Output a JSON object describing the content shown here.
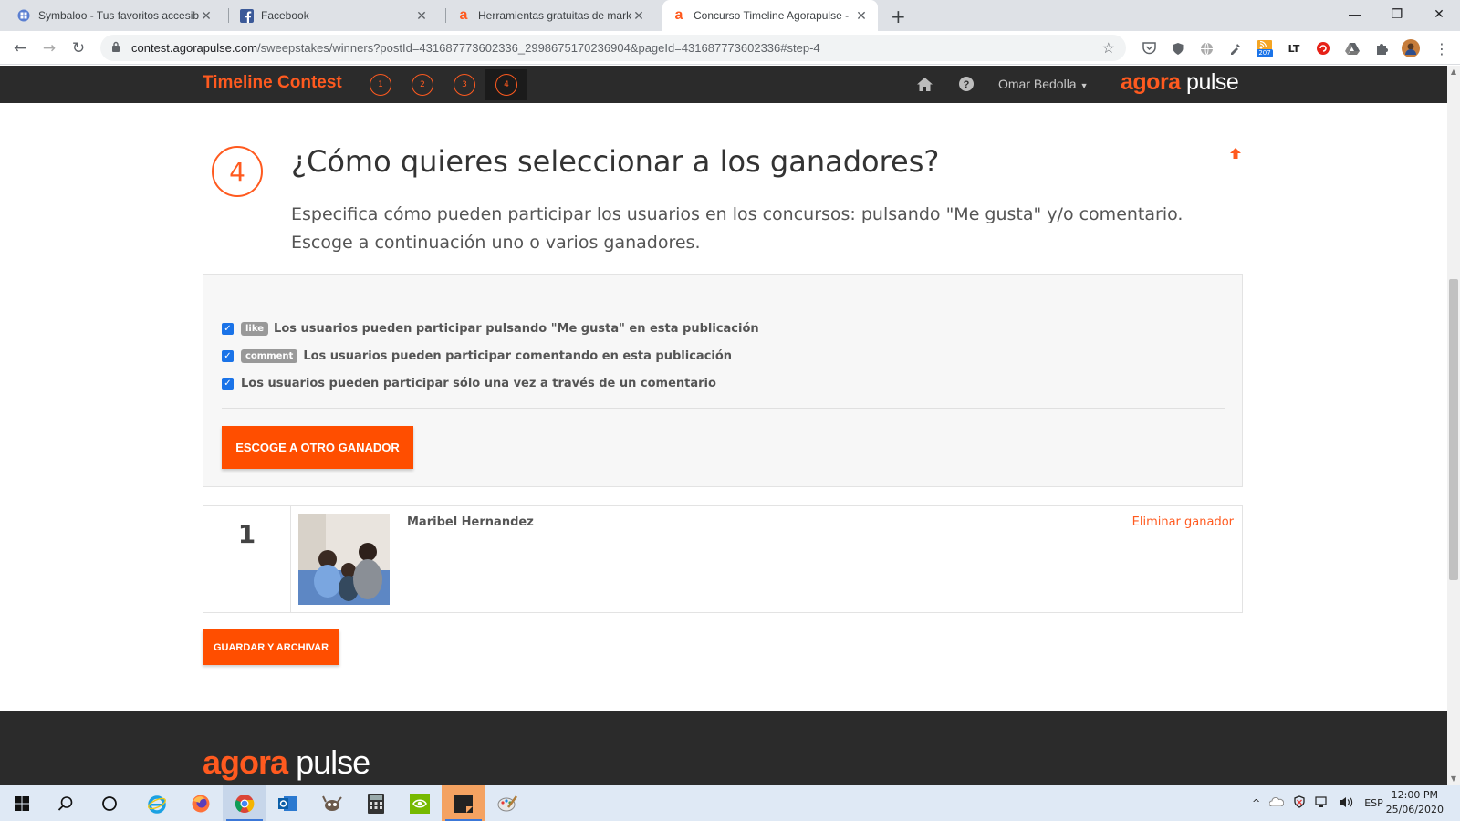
{
  "browser": {
    "tabs": [
      {
        "title": "Symbaloo - Tus favoritos accesib",
        "active": false
      },
      {
        "title": "Facebook",
        "active": false
      },
      {
        "title": "Herramientas gratuitas de marke",
        "active": false
      },
      {
        "title": "Concurso Timeline Agorapulse -",
        "active": true
      }
    ],
    "new_tab": "+",
    "url_host": "contest.agorapulse.com",
    "url_path": "/sweepstakes/winners?postId=431687773602336_2998675170236904&pageId=431687773602336#step-4",
    "extension_badge": "207",
    "window_controls": {
      "minimize": "—",
      "restore": "❐",
      "close": "✕"
    }
  },
  "app": {
    "title": "Timeline Contest",
    "steps": [
      "1",
      "2",
      "3",
      "4"
    ],
    "active_step": "4",
    "user_name": "Omar Bedolla",
    "logo_agora": "agora",
    "logo_pulse": "pulse",
    "colors": {
      "accent": "#ff5a1f",
      "header_bg": "#2b2b2b",
      "button": "#ff4e00"
    }
  },
  "step": {
    "number": "4",
    "title": "¿Cómo quieres seleccionar a los ganadores?",
    "description_line1": "Especifica cómo pueden participar los usuarios en los concursos: pulsando \"Me gusta\" y/o comentario.",
    "description_line2": "Escoge a continuación uno o varios ganadores."
  },
  "options": [
    {
      "tag": "like",
      "label": "Los usuarios pueden participar pulsando \"Me gusta\" en esta publicación",
      "checked": true
    },
    {
      "tag": "comment",
      "label": "Los usuarios pueden participar comentando en esta publicación",
      "checked": true
    },
    {
      "tag": "",
      "label": "Los usuarios pueden participar sólo una vez a través de un comentario",
      "checked": true
    }
  ],
  "choose_button": "ESCOGE A OTRO GANADOR",
  "winners": [
    {
      "rank": "1",
      "name": "Maribel Hernandez",
      "remove": "Eliminar ganador"
    }
  ],
  "save_button": "GUARDAR Y ARCHIVAR",
  "footer": {
    "logo_agora": "agora",
    "logo_pulse": "pulse"
  },
  "taskbar": {
    "language": "ESP",
    "time": "12:00 PM",
    "date": "25/06/2020"
  }
}
